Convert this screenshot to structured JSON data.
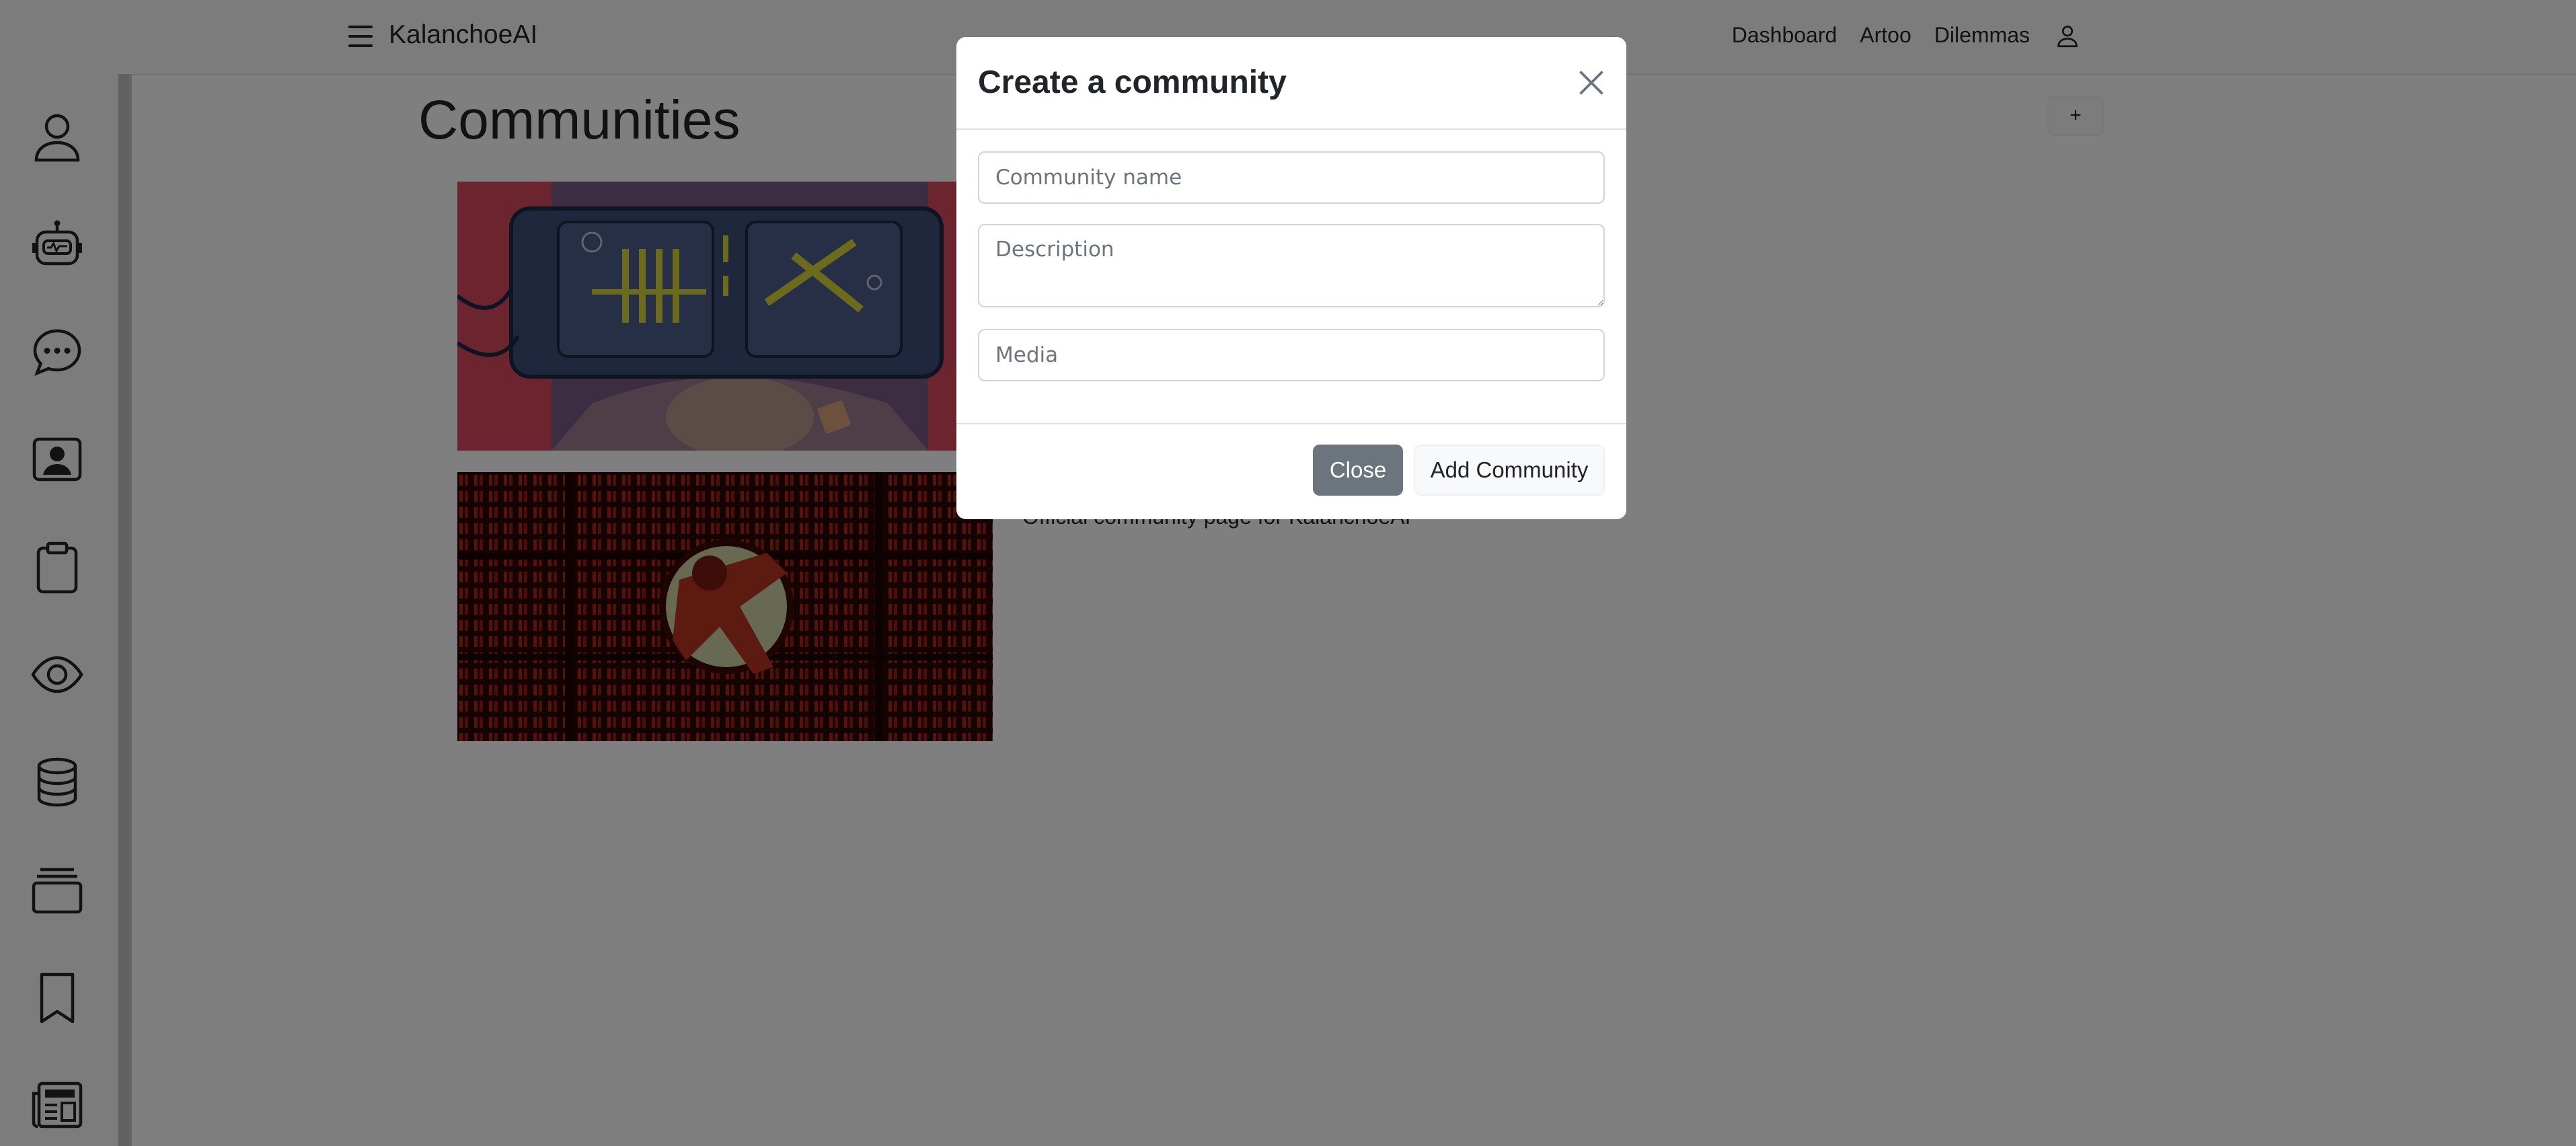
{
  "navbar": {
    "brand": "KalanchoeAI",
    "links": [
      "Dashboard",
      "Artoo",
      "Dilemmas"
    ]
  },
  "sidebar": {
    "items": [
      {
        "icon": "person-icon"
      },
      {
        "icon": "robot-icon"
      },
      {
        "icon": "chat-icon"
      },
      {
        "icon": "person-badge-icon"
      },
      {
        "icon": "clipboard-icon"
      },
      {
        "icon": "eye-icon"
      },
      {
        "icon": "database-icon"
      },
      {
        "icon": "collection-icon"
      },
      {
        "icon": "bookmark-icon"
      },
      {
        "icon": "newspaper-icon"
      }
    ]
  },
  "main": {
    "title": "Communities",
    "add_label": "+",
    "cards": [
      {
        "description": ""
      },
      {
        "description": "Official community page for KalanchoeAI"
      }
    ]
  },
  "modal": {
    "title": "Create a community",
    "name_placeholder": "Community name",
    "description_placeholder": "Description",
    "media_placeholder": "Media",
    "close_label": "Close",
    "add_label": "Add Community"
  },
  "colors": {
    "backdrop": "#808080",
    "close_button": "#6c757d",
    "card_red": "#b02418",
    "card_pink": "#d94a5e"
  }
}
